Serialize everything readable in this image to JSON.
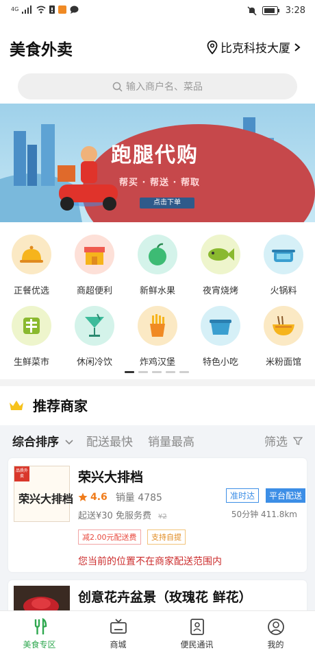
{
  "status_bar": {
    "network": "4G",
    "time": "3:28"
  },
  "header": {
    "title": "美食外卖",
    "location": "比克科技大厦"
  },
  "search": {
    "placeholder": "输入商户名、菜品"
  },
  "banner": {
    "title": "跑腿代购",
    "subtitle": "帮买 · 帮送 · 帮取",
    "button": "点击下单"
  },
  "categories": [
    {
      "label": "正餐优选",
      "icon": "food-cloche-icon",
      "bg": "#fbe9c4"
    },
    {
      "label": "商超便利",
      "icon": "shop-icon",
      "bg": "#fde0d8"
    },
    {
      "label": "新鲜水果",
      "icon": "apple-icon",
      "bg": "#d4f3ea"
    },
    {
      "label": "夜宵烧烤",
      "icon": "fish-icon",
      "bg": "#eef5cc"
    },
    {
      "label": "火锅料",
      "icon": "hotpot-icon",
      "bg": "#d6f0f7"
    },
    {
      "label": "生鲜菜市",
      "icon": "fresh-character-icon",
      "bg": "#eef5cc"
    },
    {
      "label": "休闲冷饮",
      "icon": "cocktail-icon",
      "bg": "#d4f3ea"
    },
    {
      "label": "炸鸡汉堡",
      "icon": "fries-icon",
      "bg": "#fbe9c4"
    },
    {
      "label": "特色小吃",
      "icon": "lunchbox-icon",
      "bg": "#d6f0f7"
    },
    {
      "label": "米粉面馆",
      "icon": "noodle-bowl-icon",
      "bg": "#fbe9c4"
    }
  ],
  "recommend": {
    "title": "推荐商家"
  },
  "sort": {
    "items": [
      "综合排序",
      "配送最快",
      "销量最高"
    ],
    "filter": "筛选"
  },
  "shops": [
    {
      "logo_tag": "品质外卖",
      "logo_text": "荣兴大排档",
      "name": "荣兴大排档",
      "rating": "4.6",
      "sales": "销量 4785",
      "tag_fast": "准时达",
      "tag_platform": "平台配送",
      "delivery": "起送¥30  免服务费",
      "delivery_strike": "¥2",
      "distance": "50分钟 411.8km",
      "promo1": "减2.00元配送费",
      "promo2": "支持自提",
      "warning": "您当前的位置不在商家配送范围内"
    },
    {
      "name": "创意花卉盆景（玫瑰花 鲜花）"
    }
  ],
  "tabs": [
    "美食专区",
    "商城",
    "便民通讯",
    "我的"
  ],
  "colors": {
    "accent": "#3c8ee6",
    "warn": "#cc2d2d",
    "rating": "#f07c1b",
    "active_tab": "#2fa84f"
  }
}
